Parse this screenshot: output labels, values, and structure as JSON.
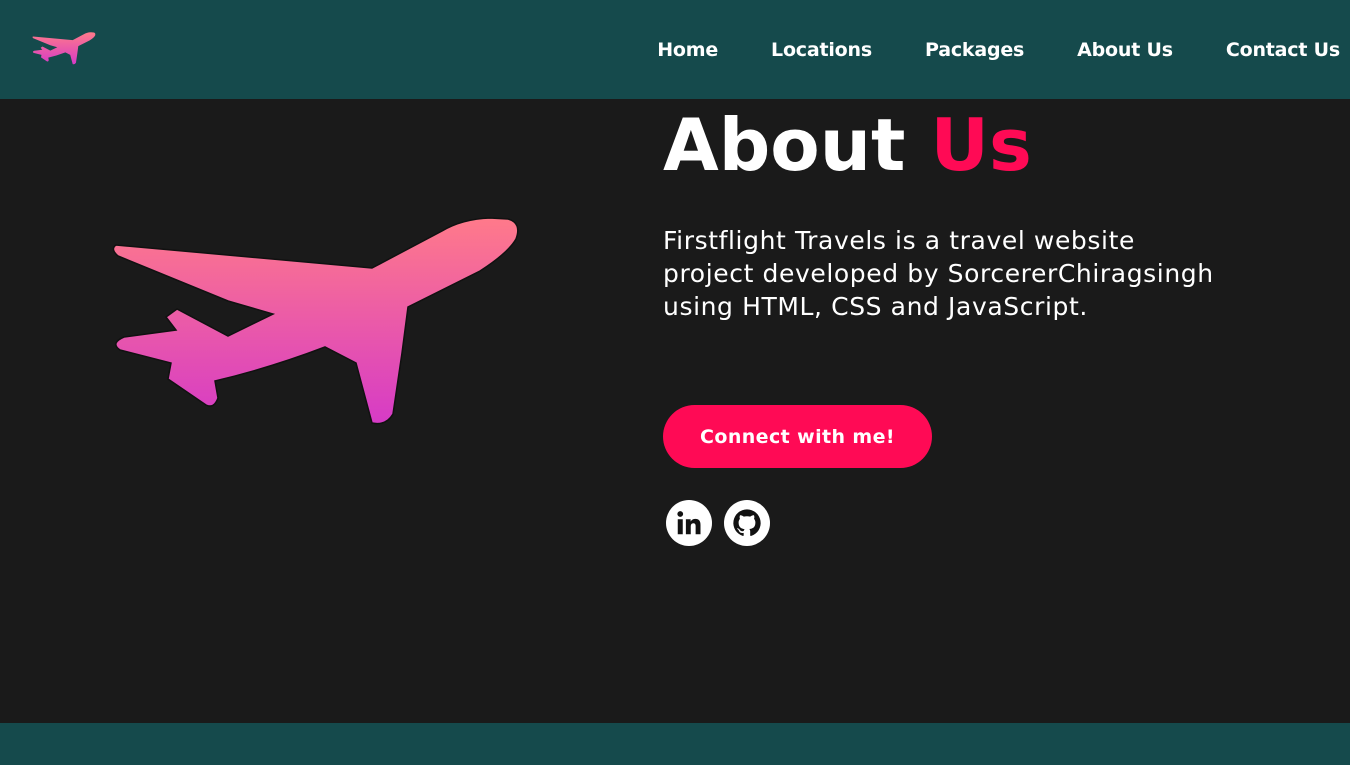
{
  "nav": {
    "logo_icon": "airplane-icon",
    "links": [
      {
        "label": "Home"
      },
      {
        "label": "Locations"
      },
      {
        "label": "Packages"
      },
      {
        "label": "About Us"
      },
      {
        "label": "Contact Us"
      }
    ]
  },
  "about": {
    "title_main": "About",
    "title_accent": "Us",
    "description": "Firstflight Travels is a travel website project developed by SorcererChiragsingh using HTML, CSS and JavaScript.",
    "cta_label": "Connect with me!",
    "hero_icon": "airplane-illustration",
    "social": [
      {
        "icon": "linkedin-icon"
      },
      {
        "icon": "github-icon"
      }
    ]
  },
  "colors": {
    "nav_bg": "#154a4c",
    "page_bg": "#1a1a1a",
    "accent": "#ff0a55",
    "plane_gradient_top": "#ff7a8a",
    "plane_gradient_bottom": "#d63bc6"
  }
}
